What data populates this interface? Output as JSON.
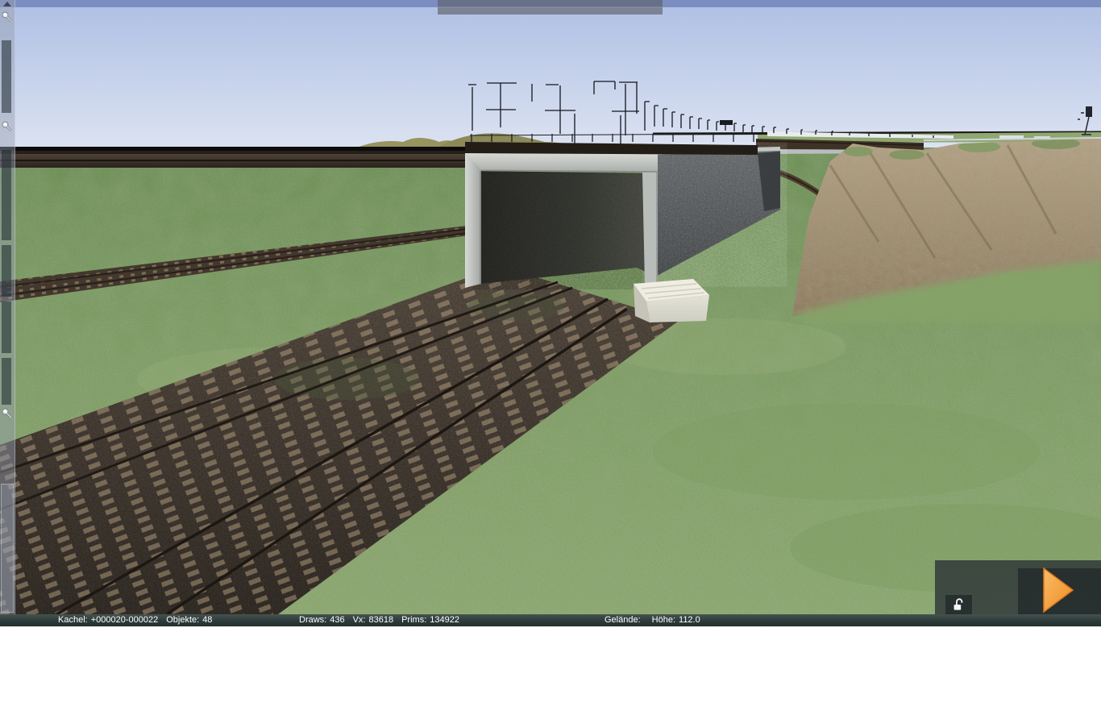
{
  "window": {
    "type": "3d-editor-viewport"
  },
  "colors": {
    "accent_play_orange": "#F09A3C",
    "statusbar_bg": "#2C3A3A",
    "sky": "#B9C9E8",
    "sky_top_band": "#8496CD",
    "grass": "#83A166",
    "toolbar_handle": "#7B8294",
    "concrete_light": "#CFD2CE",
    "concrete_dark_wall": "#4A4E50"
  },
  "statusbar": {
    "kachel": {
      "label": "Kachel:",
      "value": "+000020-000022"
    },
    "objekte": {
      "label": "Objekte:",
      "value": "48"
    },
    "draws": {
      "label": "Draws:",
      "value": "436"
    },
    "vx": {
      "label": "Vx:",
      "value": "83618"
    },
    "prims": {
      "label": "Prims:",
      "value": "134922"
    },
    "gelaende": {
      "label": "Gelände:"
    },
    "hoehe": {
      "label": "Höhe:",
      "value": "112.0"
    }
  },
  "icons": {
    "sidebar_pins": [
      "pushpin-icon",
      "pushpin-icon",
      "pushpin-icon"
    ],
    "lock": "lock-open-icon",
    "play": "play-icon",
    "collapse_arrow": "collapse-arrow-icon"
  }
}
